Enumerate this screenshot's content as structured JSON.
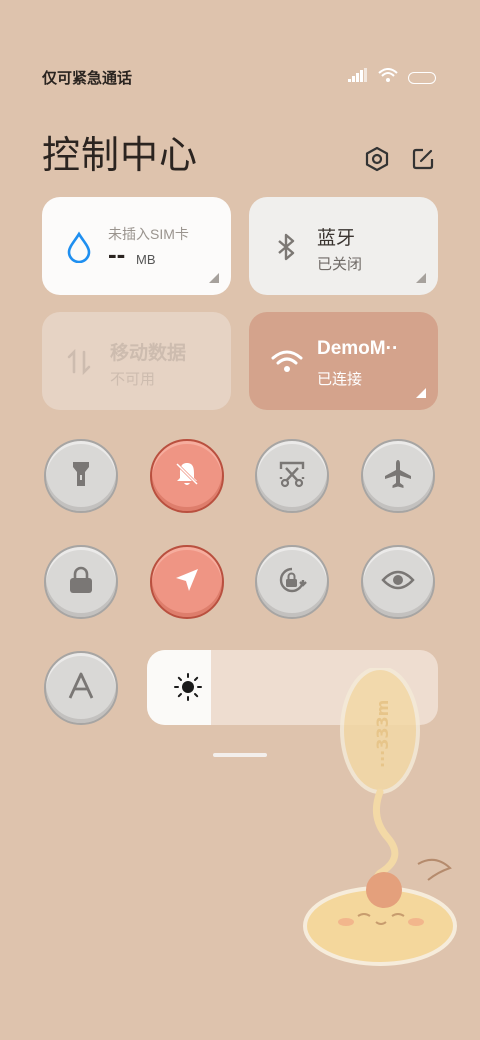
{
  "status_bar": {
    "carrier": "仅可紧急通话"
  },
  "header": {
    "title": "控制中心"
  },
  "tiles": {
    "data_usage": {
      "label": "未插入SIM卡",
      "value": "--",
      "unit": "MB"
    },
    "bluetooth": {
      "label": "蓝牙",
      "status": "已关闭"
    },
    "mobile_data": {
      "label": "移动数据",
      "status": "不可用"
    },
    "wifi": {
      "label": "DemoM··",
      "status": "已连接"
    }
  },
  "toggles": [
    {
      "name": "flashlight",
      "active": false
    },
    {
      "name": "mute",
      "active": true
    },
    {
      "name": "screenshot",
      "active": false
    },
    {
      "name": "airplane-mode",
      "active": false
    },
    {
      "name": "lock-screen",
      "active": false
    },
    {
      "name": "location",
      "active": true
    },
    {
      "name": "auto-rotate",
      "active": false
    },
    {
      "name": "reading-mode",
      "active": false
    },
    {
      "name": "auto-brightness",
      "active": false
    }
  ],
  "brightness": {
    "level": 0.22
  },
  "wallpaper": {
    "balloon_text": "···333m"
  },
  "colors": {
    "background": "#dec3ad",
    "active_toggle": "#ef9584",
    "wifi_tile": "#d4a38c",
    "tile_white": "#fcfbfa"
  }
}
